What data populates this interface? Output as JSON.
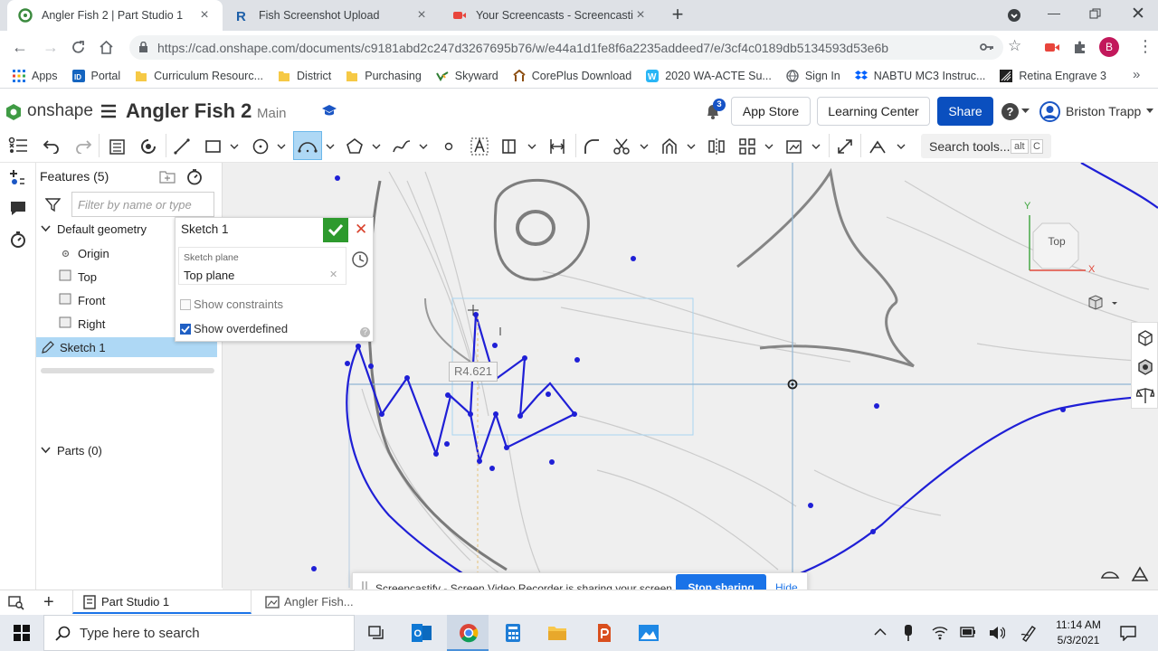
{
  "browser": {
    "tabs": [
      {
        "title": "Angler Fish 2 | Part Studio 1",
        "active": true
      },
      {
        "title": "Fish Screenshot Upload",
        "active": false
      },
      {
        "title": "Your Screencasts - Screencastify",
        "active": false
      }
    ],
    "new_tab": "+",
    "url": "https://cad.onshape.com/documents/c9181abd2c247d3267695b76/w/e44a1d1fe8f6a2235addeed7/e/3cf4c0189db5134593d53e6b",
    "profile_letter": "B",
    "bookmarks": [
      {
        "label": "Apps",
        "icon": "apps-grid-icon"
      },
      {
        "label": "Portal",
        "icon": "portal-icon"
      },
      {
        "label": "Curriculum Resourc...",
        "icon": "folder-icon"
      },
      {
        "label": "District",
        "icon": "folder-icon"
      },
      {
        "label": "Purchasing",
        "icon": "folder-icon"
      },
      {
        "label": "Skyward",
        "icon": "skyward-icon"
      },
      {
        "label": "CorePlus Download",
        "icon": "coreplus-icon"
      },
      {
        "label": "2020 WA-ACTE Su...",
        "icon": "w-icon"
      },
      {
        "label": "Sign In",
        "icon": "globe-icon"
      },
      {
        "label": "NABTU MC3 Instruc...",
        "icon": "dropbox-icon"
      },
      {
        "label": "Retina Engrave 3",
        "icon": "retina-icon"
      }
    ],
    "more": "»"
  },
  "onshape": {
    "brand": "onshape",
    "doc_title": "Angler Fish 2",
    "branch": "Main",
    "notif_count": "3",
    "app_store": "App Store",
    "learning_center": "Learning Center",
    "share": "Share",
    "help": "?",
    "user": "Briston Trapp",
    "search_tools": "Search tools...",
    "search_shortcut_1": "alt",
    "search_shortcut_2": "C"
  },
  "features": {
    "title": "Features (5)",
    "filter_placeholder": "Filter by name or type",
    "default_geometry": "Default geometry",
    "items": [
      "Origin",
      "Top",
      "Front",
      "Right"
    ],
    "sketch": "Sketch 1",
    "parts": "Parts (0)"
  },
  "sketch_dialog": {
    "title": "Sketch 1",
    "plane_label": "Sketch plane",
    "plane_value": "Top plane",
    "show_constraints": "Show constraints",
    "show_constraints_checked": false,
    "show_overdefined": "Show overdefined",
    "show_overdefined_checked": true
  },
  "canvas": {
    "dimension": "R4.621",
    "view_label": "Top",
    "axis_x": "X",
    "axis_y": "Y"
  },
  "bottom": {
    "tab_part_studio": "Part Studio 1",
    "tab_image": "Angler Fish..."
  },
  "screencast": {
    "message": "Screencastify - Screen Video Recorder is sharing your screen.",
    "stop": "Stop sharing",
    "hide": "Hide"
  },
  "taskbar": {
    "search_placeholder": "Type here to search",
    "time": "11:14 AM",
    "date": "5/3/2021"
  },
  "colors": {
    "onshape_blue": "#0a4fbf",
    "sketch_blue": "#1f1fd6",
    "selection": "#aed8f5",
    "accept_green": "#2d9a2d",
    "cancel_red": "#d9412c"
  }
}
